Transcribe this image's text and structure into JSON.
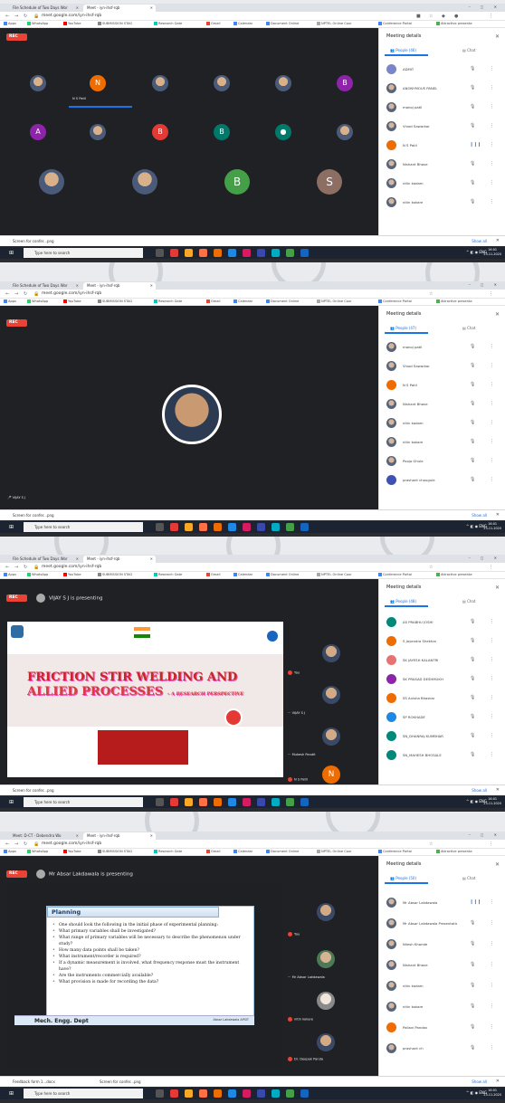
{
  "colors": {
    "accent": "#1a73e8",
    "rec": "#ea4335",
    "stage": "#202124",
    "taskbar": "#1d2431"
  },
  "browser": {
    "tabs_p1": [
      "File Schedule of Two Days Wor",
      "Meet - iyn-ihsf-rqb"
    ],
    "tabs_p4": [
      "Meet: D-CT - Debendra Wo",
      "Meet - iyn-ihsf-rqb"
    ],
    "url": "meet.google.com/iyn-ihsf-rqb",
    "bookmarks": [
      "Apps",
      "WhatsApp",
      "YouTube",
      "SUBMISSION STAG",
      "Research Gate",
      "Gmail",
      "Calendar",
      "Document Online",
      "NPTEL Online Cour",
      "Conference Portal",
      "Attractive presenta"
    ],
    "win_controls": "–  ◻  ✕"
  },
  "meeting": {
    "rec_label": "REC",
    "sidebar_title": "Meeting details",
    "chat_label": "Chat",
    "status_text": "Screen for confer...png",
    "status_text_p4b": "Feedback form 1...docx",
    "show_all": "Show all",
    "taskbar_search": "Type here to search",
    "taskbar_time": "16:01",
    "taskbar_date": "23-11-2020"
  },
  "panel1": {
    "people_tab": "People (46)",
    "active_speaker": "N S Patil",
    "tiles": [
      {
        "kind": "photo"
      },
      {
        "kind": "letter",
        "letter": "N",
        "color": "#ef6c00"
      },
      {
        "kind": "photo"
      },
      {
        "kind": "photo"
      },
      {
        "kind": "photo"
      },
      {
        "kind": "letter",
        "letter": "B",
        "color": "#8e24aa"
      },
      {
        "kind": "letter",
        "letter": "A",
        "color": "#8e24aa"
      },
      {
        "kind": "photo"
      },
      {
        "kind": "letter",
        "letter": "B",
        "color": "#e53935"
      },
      {
        "kind": "letter",
        "letter": "B",
        "color": "#00796b"
      },
      {
        "kind": "photo"
      },
      {
        "kind": "photo"
      },
      {
        "kind": "photo"
      },
      {
        "kind": "photo"
      },
      {
        "kind": "letter",
        "letter": "B",
        "color": "#43a047"
      },
      {
        "kind": "letter",
        "letter": "S",
        "color": "#8d6e63"
      }
    ],
    "people": [
      {
        "name": "ADMIT",
        "color": "#7986cb",
        "mic_on": false
      },
      {
        "name": "ANONYMOUS PANEL",
        "color": "#888",
        "mic_on": false
      },
      {
        "name": "manoj patil",
        "color": "#888",
        "mic_on": false
      },
      {
        "name": "Vinod Sawarkar",
        "color": "#888",
        "mic_on": false
      },
      {
        "name": "N S Patil",
        "color": "#ef6c00",
        "mic_on": true
      },
      {
        "name": "Nishant Bhave",
        "color": "#555",
        "mic_on": false
      },
      {
        "name": "nitin kadam",
        "color": "#888",
        "mic_on": false
      },
      {
        "name": "nitin kokare",
        "color": "#888",
        "mic_on": false
      }
    ]
  },
  "panel2": {
    "people_tab": "People (47)",
    "pinned_name": "VIJAY S J",
    "people": [
      {
        "name": "manoj patil",
        "color": "#888"
      },
      {
        "name": "Vinod Sawarkar",
        "color": "#888"
      },
      {
        "name": "N S Patil",
        "color": "#ef6c00"
      },
      {
        "name": "Nishant Bhave",
        "color": "#555"
      },
      {
        "name": "nitin kadam",
        "color": "#888"
      },
      {
        "name": "nitin kokare",
        "color": "#888"
      },
      {
        "name": "Pooja Ghule",
        "color": "#888"
      },
      {
        "name": "prashant chougule",
        "color": "#3f51b5"
      }
    ]
  },
  "panel3": {
    "presenting": "VIJAY S J is presenting",
    "people_tab": "People (48)",
    "slide_title_line1": "FRICTION STIR WELDING AND",
    "slide_title_line2": "ALLIED PROCESSES",
    "slide_subtitle": "– A RESEARCH PERSPECTIVE",
    "rail": [
      "You",
      "VIJAY S J",
      "Mukesh Pandit",
      "N S Patil"
    ],
    "rail_letter": "N",
    "people": [
      {
        "name": "AS PRABHU JOSHI",
        "color": "#00897b"
      },
      {
        "name": "S Jayendra Shekhar",
        "color": "#ef6c00"
      },
      {
        "name": "SK JAYESH KALANTRI",
        "color": "#e57373"
      },
      {
        "name": "SK PRASAD DESHMUKH",
        "color": "#8e24aa"
      },
      {
        "name": "SS Anisha Bhaskar",
        "color": "#ef6c00"
      },
      {
        "name": "SP ROKHADE",
        "color": "#1e88e5"
      },
      {
        "name": "SN_DHANRAJ KUMBHAR",
        "color": "#00897b"
      },
      {
        "name": "SN_MAHESH BHOSALE",
        "color": "#00897b"
      }
    ]
  },
  "panel4": {
    "presenting": "Mr Absar Lakdawala is presenting",
    "people_tab": "People (50)",
    "slide_heading": "Planning",
    "slide_bullets": [
      "One should look the following in the initial phase of experimental planning:",
      "What primary variables shall be investigated?",
      "What range of primary variables will be necessary to describe the phenomenon under study?",
      "How many data points shall be taken?",
      "What instrument/recorder is required?",
      "If a dynamic measurement is involved, what frequency response must the instrument have?",
      "Are the instruments commercially available?",
      "What provision is made for recording the data?"
    ],
    "slide_footer": "Mech. Engg. Dept",
    "slide_footer2": "Absar Lakdawala APSIT",
    "rail": [
      "You",
      "Mr Absar Lakdawala",
      "nitin kokare",
      "Dr. Deepak Panda"
    ],
    "people": [
      {
        "name": "Mr Absar Lakdawala",
        "color": "#777",
        "mic_on": true
      },
      {
        "name": "Mr Absar Lakdawala Presentation",
        "color": "#777",
        "mic_on": false
      },
      {
        "name": "Nilesh Khande",
        "color": "#888",
        "mic_on": false
      },
      {
        "name": "Nishant Bhave",
        "color": "#555",
        "mic_on": false
      },
      {
        "name": "nitin kadam",
        "color": "#888",
        "mic_on": false
      },
      {
        "name": "nitin kokare",
        "color": "#888",
        "mic_on": false
      },
      {
        "name": "Pallavi Pandav",
        "color": "#ef6c00",
        "mic_on": false
      },
      {
        "name": "prashant ch",
        "color": "#888",
        "mic_on": false
      }
    ]
  }
}
